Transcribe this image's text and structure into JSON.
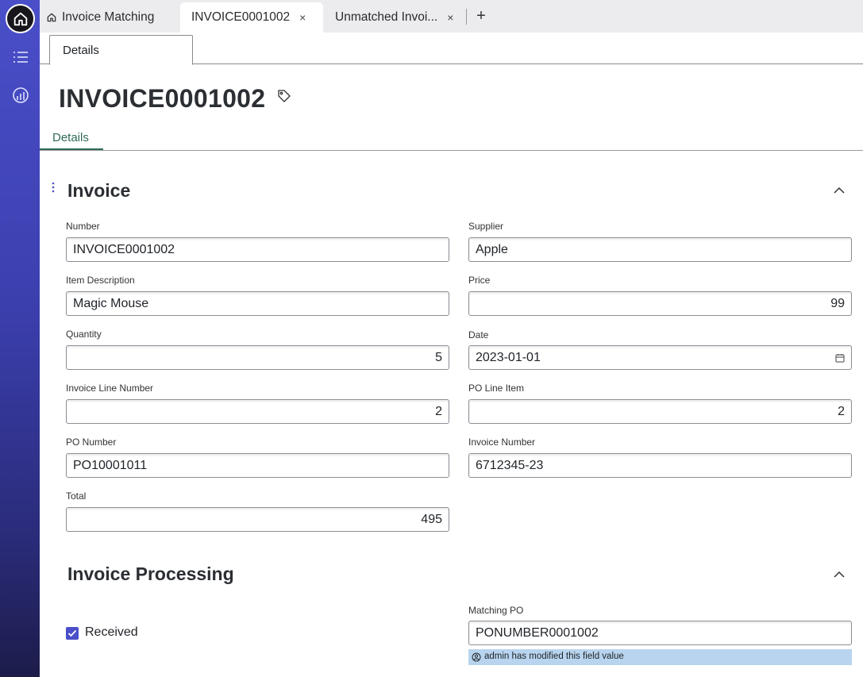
{
  "tabs": [
    {
      "label": "Invoice Matching",
      "icon": "home-icon",
      "closable": false
    },
    {
      "label": "INVOICE0001002",
      "closable": true,
      "active": true
    },
    {
      "label": "Unmatched Invoi...",
      "closable": true
    }
  ],
  "tab_close_glyph": "×",
  "tab_add_glyph": "+",
  "subtab": {
    "label": "Details"
  },
  "record": {
    "title": "INVOICE0001002"
  },
  "form_tab": {
    "label": "Details"
  },
  "sections": {
    "invoice": {
      "title": "Invoice",
      "fields": {
        "number": {
          "label": "Number",
          "value": "INVOICE0001002"
        },
        "supplier": {
          "label": "Supplier",
          "value": "Apple"
        },
        "item_description": {
          "label": "Item Description",
          "value": "Magic Mouse"
        },
        "price": {
          "label": "Price",
          "value": "99"
        },
        "quantity": {
          "label": "Quantity",
          "value": "5"
        },
        "date": {
          "label": "Date",
          "value": "2023-01-01"
        },
        "invoice_line_number": {
          "label": "Invoice Line Number",
          "value": "2"
        },
        "po_line_item": {
          "label": "PO Line Item",
          "value": "2"
        },
        "po_number": {
          "label": "PO Number",
          "value": "PO10001011"
        },
        "invoice_number": {
          "label": "Invoice Number",
          "value": "6712345-23"
        },
        "total": {
          "label": "Total",
          "value": "495"
        }
      }
    },
    "processing": {
      "title": "Invoice Processing",
      "received": {
        "label": "Received",
        "checked": true
      },
      "matching_po": {
        "label": "Matching PO",
        "value": "PONUMBER0001002"
      },
      "notice": "admin has modified this field value"
    }
  },
  "colors": {
    "rail": "#4a4fc9",
    "accent_green": "#2e6b55",
    "notice_bg": "#b8d4ee",
    "checkbox": "#4a4fc9"
  }
}
